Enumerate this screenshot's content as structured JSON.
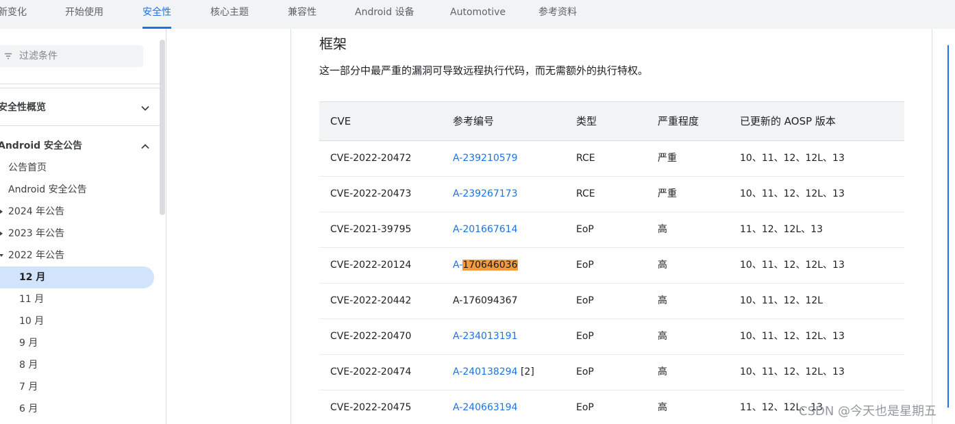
{
  "nav": {
    "tabs": [
      {
        "label": "新变化"
      },
      {
        "label": "开始使用"
      },
      {
        "label": "安全性",
        "active": true
      },
      {
        "label": "核心主题"
      },
      {
        "label": "兼容性"
      },
      {
        "label": "Android 设备"
      },
      {
        "label": "Automotive"
      },
      {
        "label": "参考资料"
      }
    ]
  },
  "sidebar": {
    "filter_placeholder": "过滤条件",
    "sections": [
      {
        "label": "安全性概览",
        "expanded": false
      },
      {
        "label": "Android 安全公告",
        "expanded": true
      }
    ],
    "items": [
      {
        "label": "公告首页"
      },
      {
        "label": "Android 安全公告"
      },
      {
        "label": "2024 年公告"
      },
      {
        "label": "2023 年公告"
      },
      {
        "label": "2022 年公告"
      },
      {
        "label": "12 月"
      },
      {
        "label": "11 月"
      },
      {
        "label": "10 月"
      },
      {
        "label": "9 月"
      },
      {
        "label": "8 月"
      },
      {
        "label": "7 月"
      },
      {
        "label": "6 月"
      }
    ]
  },
  "main": {
    "heading": "框架",
    "description": "这一部分中最严重的漏洞可导致远程执行代码，而无需额外的执行特权。",
    "table": {
      "headers": [
        "CVE",
        "参考编号",
        "类型",
        "严重程度",
        "已更新的 AOSP 版本"
      ],
      "rows": [
        {
          "cve": "CVE-2022-20472",
          "ref_prefix": "A-239210579",
          "ref_highlight": "",
          "ref_extra": "",
          "type": "RCE",
          "severity": "严重",
          "versions": "10、11、12、12L、13"
        },
        {
          "cve": "CVE-2022-20473",
          "ref_prefix": "A-239267173",
          "ref_highlight": "",
          "ref_extra": "",
          "type": "RCE",
          "severity": "严重",
          "versions": "10、11、12、12L、13"
        },
        {
          "cve": "CVE-2021-39795",
          "ref_prefix": "A-201667614",
          "ref_highlight": "",
          "ref_extra": "",
          "type": "EoP",
          "severity": "高",
          "versions": "11、12、12L、13"
        },
        {
          "cve": "CVE-2022-20124",
          "ref_prefix": "A-",
          "ref_highlight": "170646036",
          "ref_extra": "",
          "type": "EoP",
          "severity": "高",
          "versions": "10、11、12、12L、13"
        },
        {
          "cve": "CVE-2022-20442",
          "ref_plain": "A-176094367",
          "type": "EoP",
          "severity": "高",
          "versions": "10、11、12、12L"
        },
        {
          "cve": "CVE-2022-20470",
          "ref_prefix": "A-234013191",
          "ref_highlight": "",
          "ref_extra": "",
          "type": "EoP",
          "severity": "高",
          "versions": "10、11、12、12L、13"
        },
        {
          "cve": "CVE-2022-20474",
          "ref_prefix": "A-240138294",
          "ref_highlight": "",
          "ref_extra": " [2]",
          "type": "EoP",
          "severity": "高",
          "versions": "10、11、12、12L、13"
        },
        {
          "cve": "CVE-2022-20475",
          "ref_prefix": "A-240663194",
          "ref_highlight": "",
          "ref_extra": "",
          "type": "EoP",
          "severity": "高",
          "versions": "11、12、12L、13"
        }
      ]
    }
  },
  "watermark": "CSDN @今天也是星期五",
  "colors": {
    "accent": "#1a73e8",
    "highlight": "#f39c3f",
    "selected_bg": "#d2e3fc"
  }
}
